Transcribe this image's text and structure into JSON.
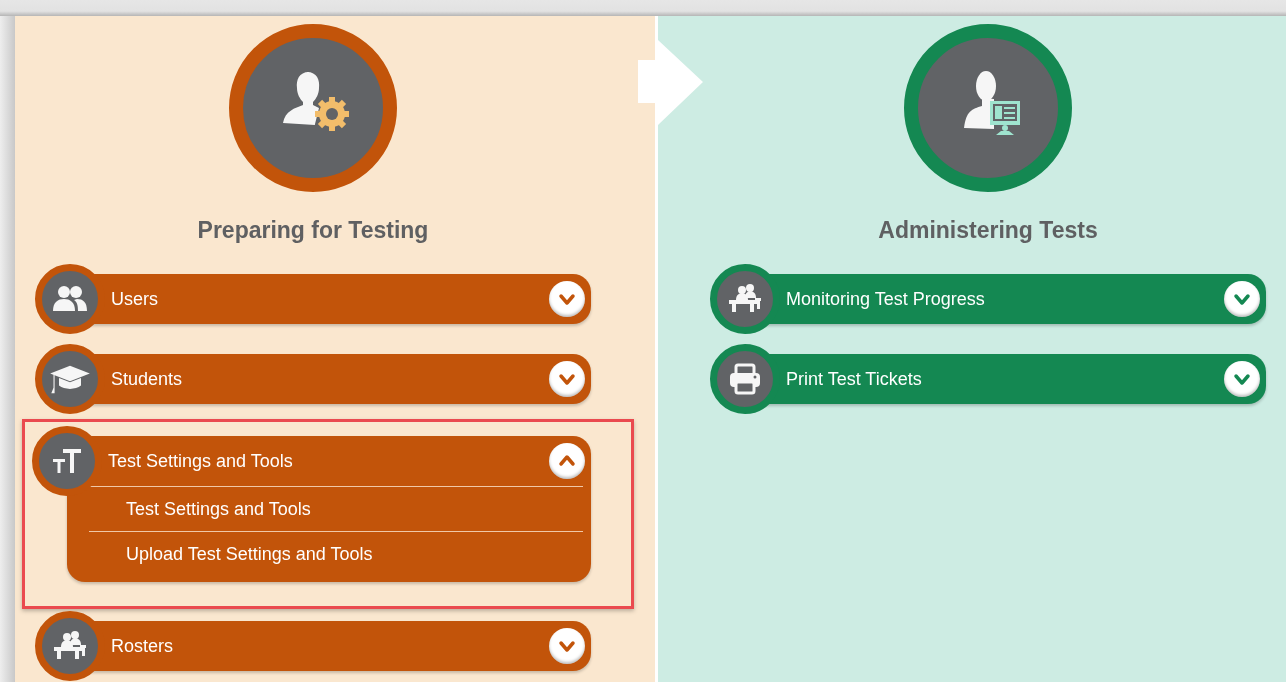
{
  "sections": [
    {
      "kind": "preparing",
      "color": "#c2540a",
      "title": "Preparing for Testing",
      "items": [
        {
          "kind": "users",
          "label": "Users",
          "expanded": false,
          "highlighted": false
        },
        {
          "kind": "students",
          "label": "Students",
          "expanded": false,
          "highlighted": false
        },
        {
          "kind": "text-size",
          "label": "Test Settings and Tools",
          "expanded": true,
          "highlighted": true,
          "children": [
            {
              "label": "Test Settings and Tools"
            },
            {
              "label": "Upload Test Settings and Tools"
            }
          ]
        },
        {
          "kind": "classroom",
          "label": "Rosters",
          "expanded": false,
          "highlighted": false
        }
      ]
    },
    {
      "kind": "administering",
      "color": "#148852",
      "title": "Administering Tests",
      "items": [
        {
          "kind": "classroom",
          "label": "Monitoring Test Progress",
          "expanded": false,
          "highlighted": false
        },
        {
          "kind": "printer",
          "label": "Print Test Tickets",
          "expanded": false,
          "highlighted": false
        }
      ]
    }
  ]
}
